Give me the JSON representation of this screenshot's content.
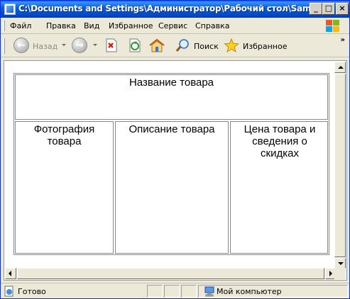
{
  "window": {
    "title": "C:\\Documents and Settings\\Администратор\\Рабочий стол\\Samples\\...",
    "min_symbol": "_",
    "max_symbol": "□",
    "close_symbol": "×"
  },
  "menu": {
    "items": [
      {
        "label": "Файл"
      },
      {
        "label": "Правка"
      },
      {
        "label": "Вид"
      },
      {
        "label": "Избранное"
      },
      {
        "label": "Сервис"
      },
      {
        "label": "Справка"
      }
    ]
  },
  "toolbar": {
    "back_label": "Назад",
    "search_label": "Поиск",
    "favorites_label": "Избранное",
    "overflow_symbol": "»"
  },
  "page": {
    "header_cell": "Название товара",
    "photo_cell": "Фотография товара",
    "description_cell": "Описание товара",
    "price_cell": "Цена товара и сведения о скидках"
  },
  "status": {
    "text": "Готово",
    "zone": "Мой компьютер"
  },
  "colors": {
    "title_bar": "#0a5fd8",
    "chrome": "#ece9d8",
    "table_border": "#8a8a8a"
  }
}
